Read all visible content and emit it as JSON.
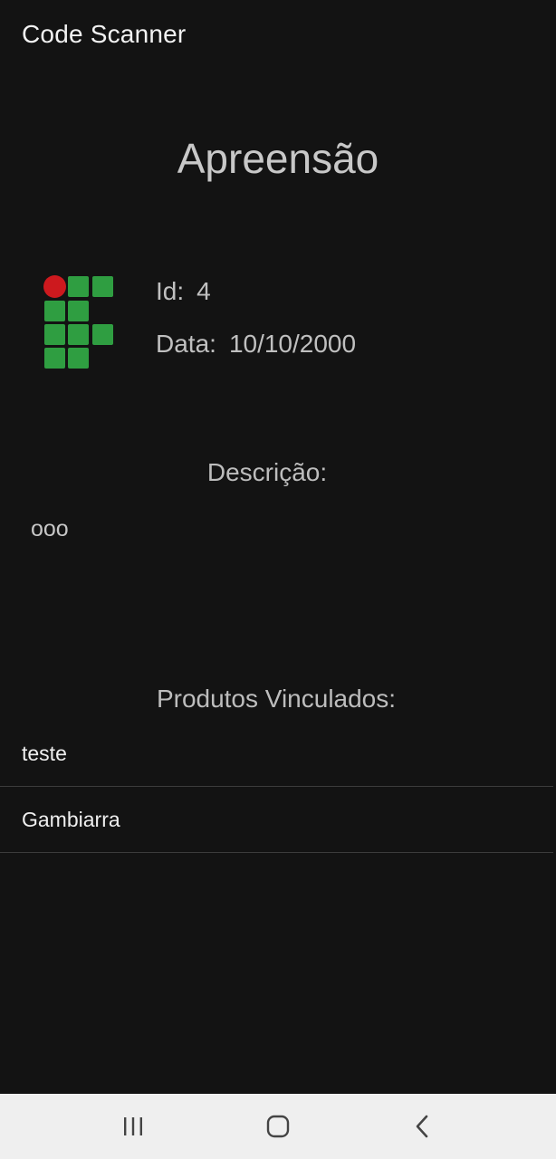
{
  "appbar": {
    "title": "Code Scanner"
  },
  "page": {
    "title": "Apreensão"
  },
  "logo": {
    "icon": "if-logo-icon",
    "colors": {
      "green": "#2f9e41",
      "red": "#cd191e"
    }
  },
  "details": {
    "id_label": "Id:",
    "id_value": "4",
    "date_label": "Data:",
    "date_value": "10/10/2000"
  },
  "description": {
    "title": "Descrição:",
    "text": "ooo"
  },
  "products": {
    "title": "Produtos Vinculados:",
    "items": [
      "teste",
      "Gambiarra"
    ]
  },
  "navbar": {
    "buttons": [
      "recent-apps-icon",
      "home-icon",
      "back-icon"
    ]
  },
  "colors": {
    "background": "#131313",
    "navbar": "#efefef",
    "divider": "#3c3c3c"
  }
}
